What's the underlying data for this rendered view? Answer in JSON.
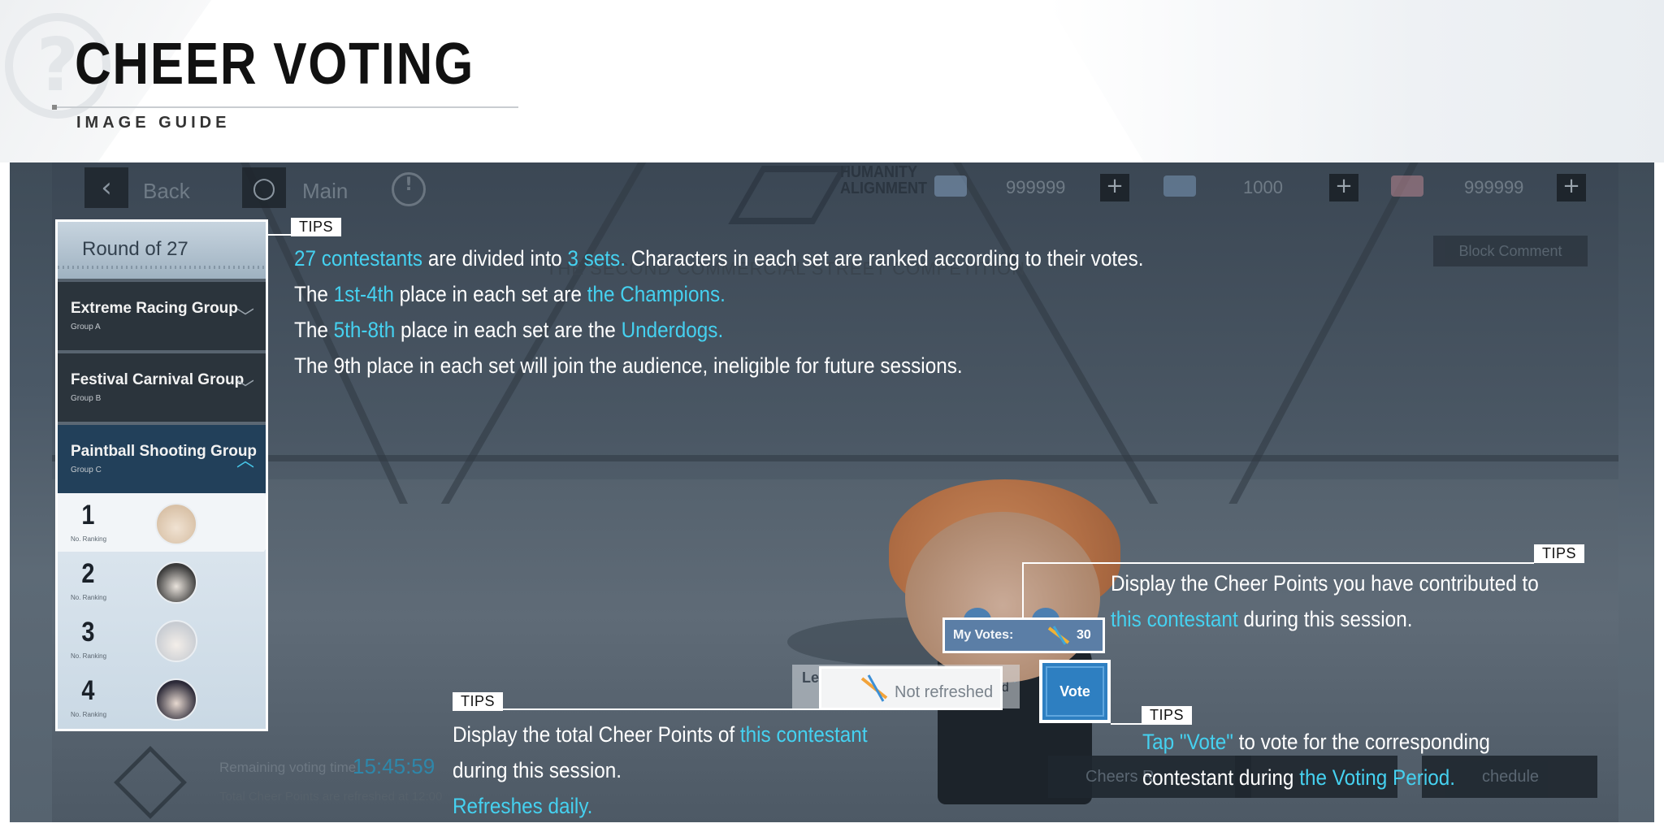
{
  "header": {
    "title": "CHEER VOTING",
    "subtitle": "IMAGE GUIDE"
  },
  "game_ui": {
    "back_label": "Back",
    "main_label": "Main",
    "brand_line1": "HUMANITY",
    "brand_line2": "ALIGNMENT",
    "resource_1": "999999",
    "resource_2": "1000",
    "resource_3": "999999",
    "competition_title": "THE SECOND COMMERCIAL STREET COMPETITION",
    "block_comment_label": "Block Comment",
    "round_label": "Round of 27",
    "groups": [
      {
        "name": "Extreme Racing Group",
        "sub": "Group A",
        "expanded": false
      },
      {
        "name": "Festival Carnival Group",
        "sub": "Group B",
        "expanded": false
      },
      {
        "name": "Paintball Shooting Group",
        "sub": "Group C",
        "expanded": true
      }
    ],
    "rankings": [
      {
        "rank": "1",
        "label": "No. Ranking",
        "avatar_color": "#d9c2a8"
      },
      {
        "rank": "2",
        "label": "No. Ranking",
        "avatar_color": "#3a3a3a"
      },
      {
        "rank": "3",
        "label": "No. Ranking",
        "avatar_color": "#c8ccd2"
      },
      {
        "rank": "4",
        "label": "No. Ranking",
        "avatar_color": "#2c2a38"
      }
    ],
    "remaining_label": "Remaining voting time",
    "remaining_time": "15:45:59",
    "refresh_note": "Total Cheer Points are refreshed at 12:00",
    "my_votes_label": "My Votes:",
    "my_votes_value": "30",
    "level_label": "Le",
    "level_suffix": "hed",
    "not_refreshed_label": "Not refreshed",
    "vote_button_label": "Vote",
    "cheers_button_label": "Cheers R",
    "schedule_button_label": "chedule"
  },
  "tips": {
    "tag": "TIPS",
    "tip1": {
      "line1_hl1": "27 contestants",
      "line1_t1": " are divided into ",
      "line1_hl2": "3 sets.",
      "line1_t2": " Characters in each set are ranked according to their votes.",
      "line2_t1": "The ",
      "line2_hl1": "1st-4th",
      "line2_t2": " place in each set are ",
      "line2_hl2": "the Champions.",
      "line3_t1": "The ",
      "line3_hl1": "5th-8th",
      "line3_t2": " place in each set are the ",
      "line3_hl2": "Underdogs.",
      "line4": "The 9th place in each set will join the audience, ineligible for future sessions."
    },
    "tip2": {
      "line1": "Display the Cheer Points you have contributed to",
      "line2_hl": "this contestant",
      "line2_t": " during this session."
    },
    "tip3": {
      "line1_t": "Display the total Cheer Points of ",
      "line1_hl": "this contestant",
      "line2": "during this session.",
      "line3_hl": "Refreshes daily."
    },
    "tip4": {
      "line1_hl": "Tap \"Vote\"",
      "line1_t": " to vote for the corresponding",
      "line2_t": "contestant during ",
      "line2_hl": "the Voting Period."
    }
  },
  "colors": {
    "highlight": "#45d1f0",
    "vote_button": "#2e7fc1",
    "panel_bg": "#4b5967"
  }
}
